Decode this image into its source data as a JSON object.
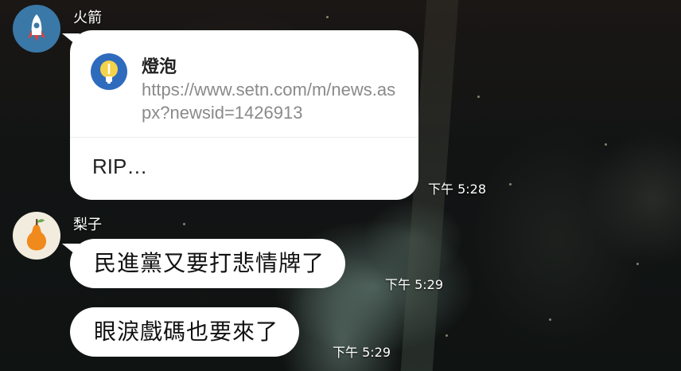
{
  "messages": [
    {
      "sender": "火箭",
      "avatar_icon": "rocket-icon",
      "link_preview": {
        "title": "燈泡",
        "icon": "lightbulb-icon",
        "url": "https://www.setn.com/m/news.aspx?newsid=1426913",
        "text": "RIP…"
      },
      "time": "下午 5:28"
    },
    {
      "sender": "梨子",
      "avatar_icon": "pear-icon",
      "text": "民進黨又要打悲情牌了",
      "time": "下午 5:29"
    },
    {
      "text": "眼淚戲碼也要來了",
      "time": "下午 5:29"
    }
  ],
  "colors": {
    "bubble": "#ffffff",
    "rocket_avatar_bg": "#3a78a8",
    "pear": "#f08a1c",
    "link_icon_bg": "#2f6bbd",
    "url_text": "#8a8a8a"
  }
}
